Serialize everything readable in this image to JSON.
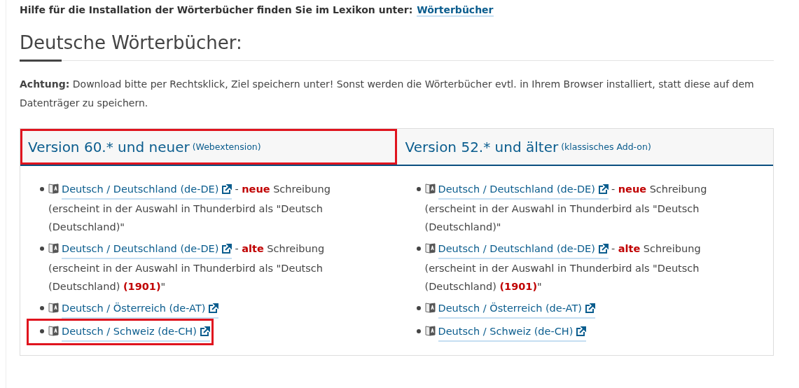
{
  "help_line": {
    "text": "Hilfe für die Installation der Wörterbücher finden Sie im Lexikon unter:",
    "link": "Wörterbücher"
  },
  "heading": "Deutsche Wörterbücher:",
  "notice": "**Achtung:** Download bitte per Rechtsklick, Ziel speichern unter! Sonst werden die Wörterbücher evtl. in Ihrem Browser installiert, statt diese auf dem Datenträger zu speichern.",
  "columns": [
    {
      "title": "Version 60.* und neuer",
      "subtitle": "(Webextension)",
      "highlighted": true,
      "items": [
        {
          "link": "Deutsch / Deutschland (de-DE)",
          "note": "- **neue** Schreibung",
          "detail": "(erscheint in der Auswahl in Thunderbird als \"Deutsch (Deutschland)\"",
          "highlighted": false
        },
        {
          "link": "Deutsch / Deutschland (de-DE)",
          "note": "- **alte** Schreibung",
          "detail": "(erscheint in der Auswahl in Thunderbird als \"Deutsch (Deutschland) **(1901)**\"",
          "highlighted": false
        },
        {
          "link": "Deutsch / Österreich (de-AT)",
          "highlighted": false
        },
        {
          "link": "Deutsch / Schweiz (de-CH)",
          "highlighted": true
        }
      ]
    },
    {
      "title": "Version 52.* und älter",
      "subtitle": "(klassisches Add-on)",
      "highlighted": false,
      "items": [
        {
          "link": "Deutsch / Deutschland (de-DE)",
          "note": "- **neue** Schreibung",
          "detail": "(erscheint in der Auswahl in Thunderbird als \"Deutsch (Deutschland)\"",
          "highlighted": false
        },
        {
          "link": "Deutsch / Deutschland (de-DE)",
          "note": "- **alte** Schreibung",
          "detail": "(erscheint in der Auswahl in Thunderbird als \"Deutsch (Deutschland) **(1901)**\"",
          "highlighted": false
        },
        {
          "link": "Deutsch / Österreich (de-AT)",
          "highlighted": false
        },
        {
          "link": "Deutsch / Schweiz (de-CH)",
          "highlighted": false
        }
      ]
    }
  ]
}
